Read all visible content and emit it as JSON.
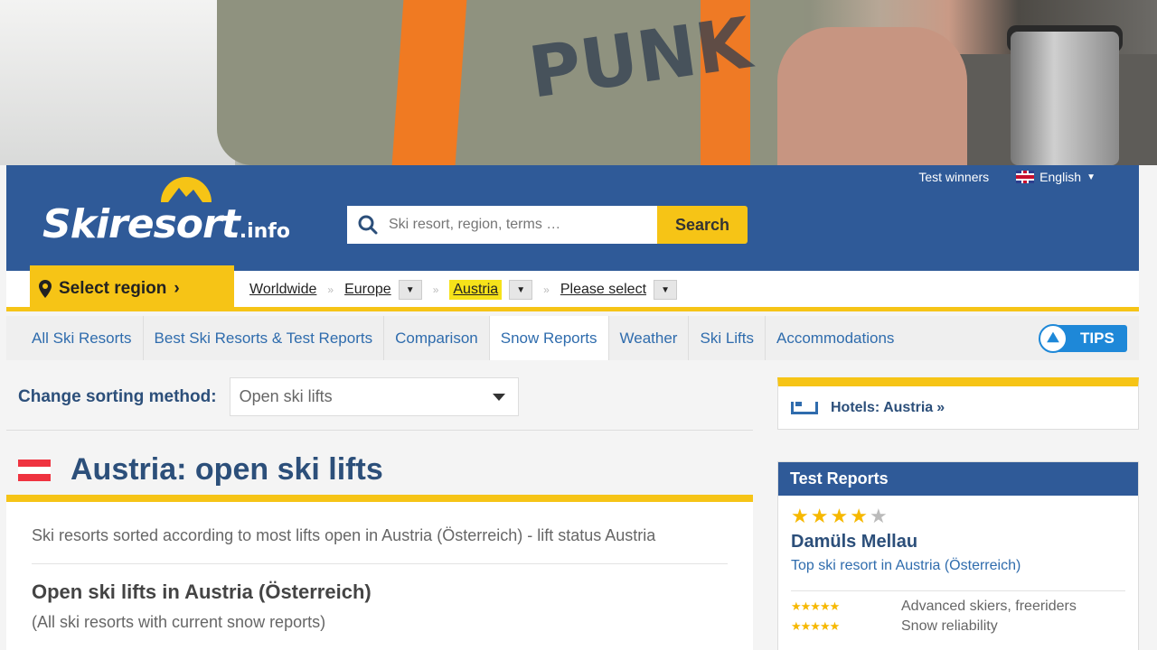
{
  "header": {
    "logo_text": "Skiresort",
    "logo_suffix": ".info",
    "top_links": {
      "test_winners": "Test winners",
      "language": "English"
    },
    "search": {
      "placeholder": "Ski resort, region, terms …",
      "button": "Search"
    }
  },
  "breadcrumb": {
    "select_region": "Select region",
    "items": [
      "Worldwide",
      "Europe",
      "Austria",
      "Please select"
    ]
  },
  "nav": {
    "tabs": [
      "All Ski Resorts",
      "Best Ski Resorts & Test Reports",
      "Comparison",
      "Snow Reports",
      "Weather",
      "Ski Lifts",
      "Accommodations"
    ],
    "active": "Snow Reports",
    "tips": "TIPS"
  },
  "sorting": {
    "label": "Change sorting method:",
    "value": "Open ski lifts"
  },
  "main": {
    "title": "Austria: open ski lifts",
    "intro": "Ski resorts sorted according to most lifts open in Austria (Österreich) - lift status Austria",
    "heading": "Open ski lifts in Austria (Österreich)",
    "subheading": "(All ski resorts with current snow reports)"
  },
  "sidebar": {
    "hotels": "Hotels: Austria",
    "test_reports": {
      "title": "Test Reports",
      "rating_stars": 4,
      "resort": "Damüls Mellau",
      "description": "Top ski resort in Austria (Österreich)",
      "ratings": [
        {
          "stars": 5,
          "label": "Advanced skiers, freeriders"
        },
        {
          "stars": 5,
          "label": "Snow reliability"
        }
      ]
    }
  },
  "colors": {
    "brand_blue": "#2f5a98",
    "accent_yellow": "#f6c416",
    "link_blue": "#2f6cad"
  }
}
